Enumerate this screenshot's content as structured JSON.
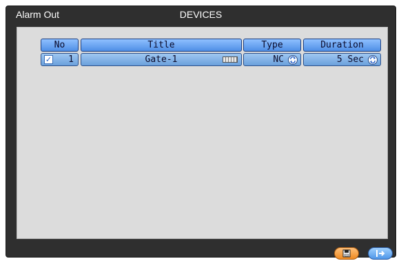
{
  "window": {
    "menu_title": "Alarm Out",
    "page_title": "DEVICES"
  },
  "table": {
    "headers": [
      "No",
      "Title",
      "Type",
      "Duration"
    ],
    "rows": [
      {
        "checked": true,
        "no": "1",
        "title": "Gate-1",
        "type": "NC",
        "duration": "5 Sec"
      }
    ]
  },
  "buttons": {
    "save_icon": "save-icon",
    "exit_icon": "exit-icon"
  },
  "colors": {
    "background": "#2f2f2f",
    "panel": "#dcdcdc",
    "header": "#4f8fe6",
    "save_button": "#ef8a22",
    "exit_button": "#4f96e8"
  }
}
